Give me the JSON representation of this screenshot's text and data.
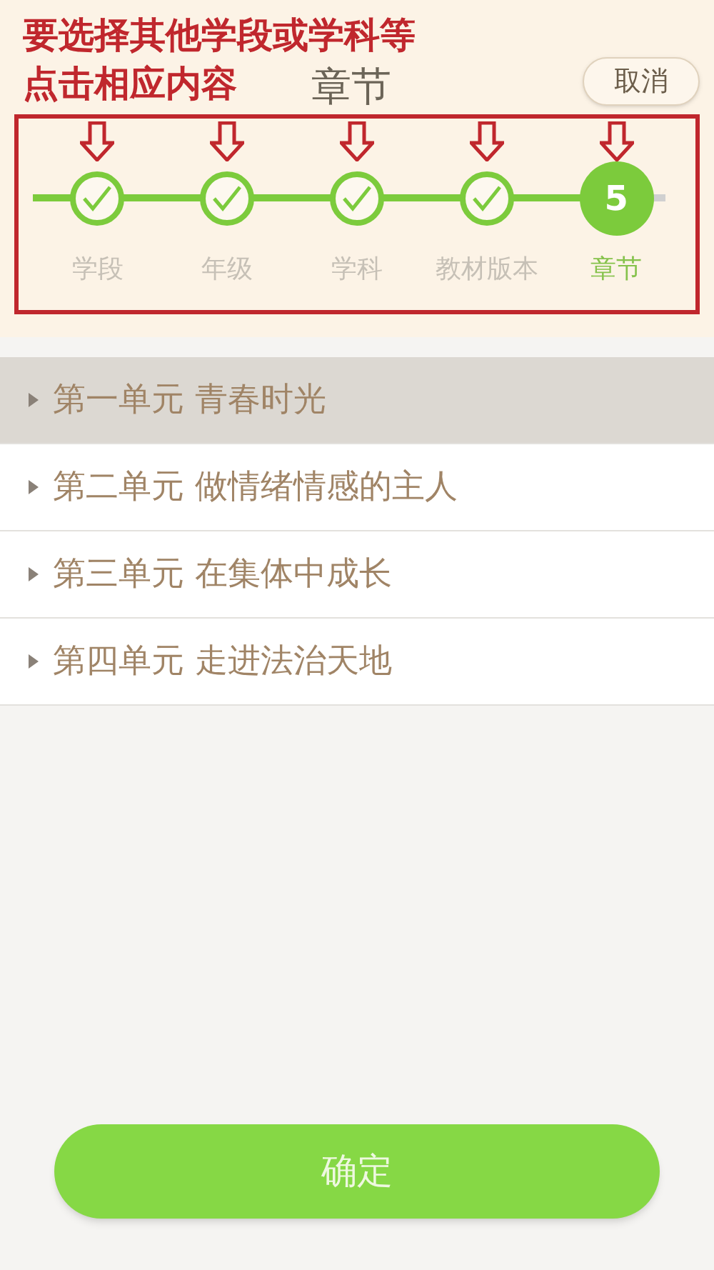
{
  "annotation": {
    "lines": [
      "要选择其他学段或学科等",
      "点击相应内容"
    ]
  },
  "header": {
    "title": "章节",
    "cancel": "取消"
  },
  "steps": [
    {
      "label": "学段",
      "kind": "done"
    },
    {
      "label": "年级",
      "kind": "done"
    },
    {
      "label": "学科",
      "kind": "done"
    },
    {
      "label": "教材版本",
      "kind": "done"
    },
    {
      "label": "章节",
      "kind": "current",
      "number": "5"
    }
  ],
  "units": [
    {
      "label": "第一单元 青春时光",
      "selected": true
    },
    {
      "label": "第二单元 做情绪情感的主人",
      "selected": false
    },
    {
      "label": "第三单元 在集体中成长",
      "selected": false
    },
    {
      "label": "第四单元 走进法治天地",
      "selected": false
    }
  ],
  "confirm": "确定"
}
